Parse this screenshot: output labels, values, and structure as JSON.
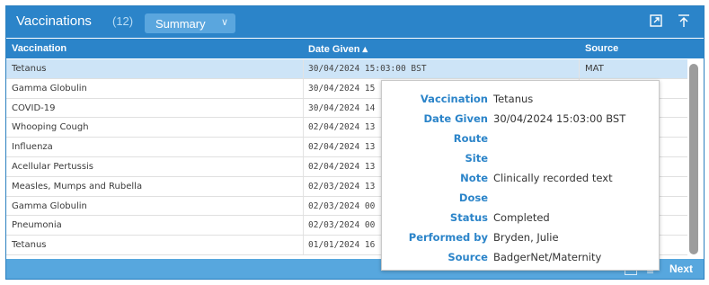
{
  "header": {
    "title": "Vaccinations",
    "count": "(12)",
    "summary_label": "Summary",
    "icons": [
      "external-link-icon",
      "collapse-to-top-icon"
    ],
    "accent": "#2b84c9"
  },
  "columns": {
    "vaccination": "Vaccination",
    "date_given": "Date Given ▴",
    "source": "Source"
  },
  "rows": [
    {
      "vaccination": "Tetanus",
      "date": "30/04/2024 15:03:00 BST",
      "source": "MAT"
    },
    {
      "vaccination": "Gamma Globulin",
      "date": "30/04/2024 15",
      "source": ""
    },
    {
      "vaccination": "COVID-19",
      "date": "30/04/2024 14",
      "source": ""
    },
    {
      "vaccination": "Whooping Cough",
      "date": "02/04/2024 13",
      "source": ""
    },
    {
      "vaccination": "Influenza",
      "date": "02/04/2024 13",
      "source": ""
    },
    {
      "vaccination": "Acellular Pertussis",
      "date": "02/04/2024 13",
      "source": ""
    },
    {
      "vaccination": "Measles, Mumps and Rubella",
      "date": "02/03/2024 13",
      "source": ""
    },
    {
      "vaccination": "Gamma Globulin",
      "date": "02/03/2024 00",
      "source": ""
    },
    {
      "vaccination": "Pneumonia",
      "date": "02/03/2024 00",
      "source": ""
    },
    {
      "vaccination": "Tetanus",
      "date": "01/01/2024 16",
      "source": ""
    }
  ],
  "footer": {
    "next_label": "Next"
  },
  "tooltip": {
    "fields": [
      {
        "label": "Vaccination",
        "value": "Tetanus"
      },
      {
        "label": "Date Given",
        "value": "30/04/2024 15:03:00 BST"
      },
      {
        "label": "Route",
        "value": ""
      },
      {
        "label": "Site",
        "value": ""
      },
      {
        "label": "Note",
        "value": "Clinically recorded text"
      },
      {
        "label": "Dose",
        "value": ""
      },
      {
        "label": "Status",
        "value": "Completed"
      },
      {
        "label": "Performed by",
        "value": "Bryden, Julie"
      },
      {
        "label": "Source",
        "value": "BadgerNet/Maternity"
      }
    ]
  }
}
